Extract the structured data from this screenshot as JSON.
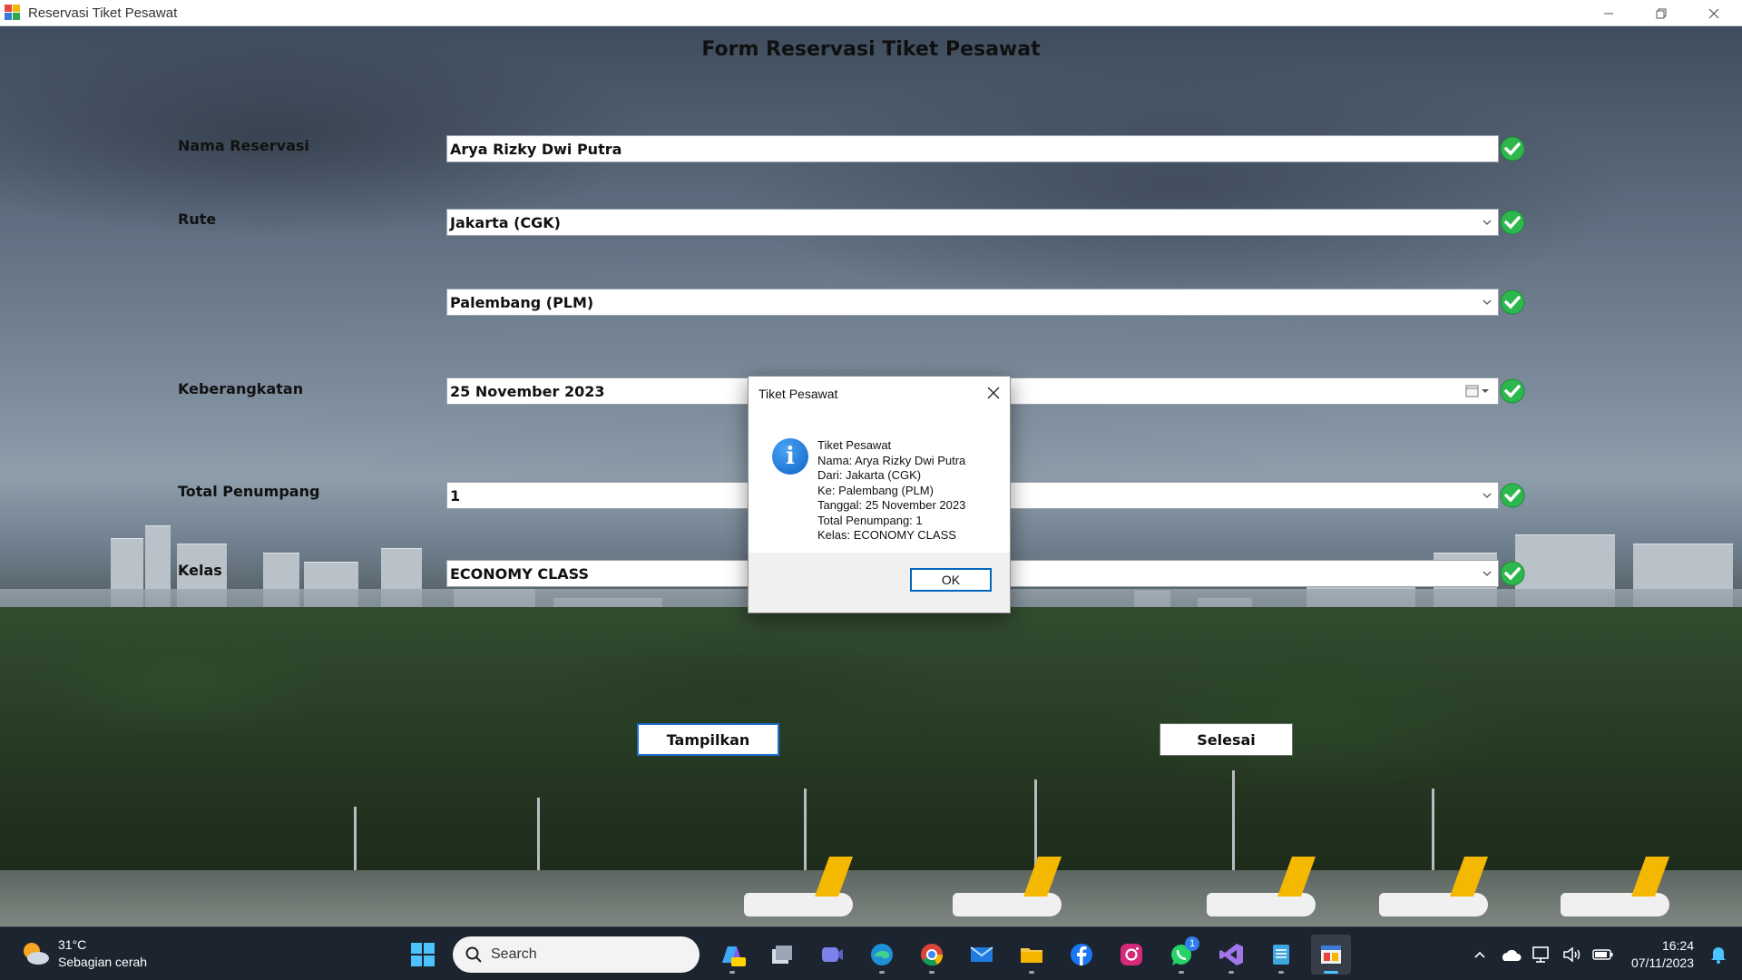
{
  "window": {
    "title": "Reservasi Tiket Pesawat",
    "minimize_icon": "minimize-icon",
    "maximize_icon": "restore-icon",
    "close_icon": "close-icon"
  },
  "form": {
    "title": "Form Reservasi Tiket Pesawat",
    "fields": {
      "nama": {
        "label": "Nama Reservasi",
        "value": "Arya Rizky Dwi Putra"
      },
      "rute_dari": {
        "label": "Rute",
        "value": "Jakarta (CGK)"
      },
      "rute_ke": {
        "value": "Palembang (PLM)"
      },
      "keberangkatan": {
        "label": "Keberangkatan",
        "value": "25 November  2023"
      },
      "penumpang": {
        "label": "Total Penumpang",
        "value": "1"
      },
      "kelas": {
        "label": "Kelas",
        "value": "ECONOMY CLASS"
      }
    },
    "buttons": {
      "tampilkan": "Tampilkan",
      "selesai": "Selesai"
    },
    "check_color": "#2db84d"
  },
  "dialog": {
    "title": "Tiket Pesawat",
    "icon": "info-icon",
    "lines": [
      "Tiket Pesawat",
      "Nama: Arya Rizky Dwi Putra",
      "Dari: Jakarta (CGK)",
      "Ke: Palembang (PLM)",
      "Tanggal: 25 November 2023",
      "Total Penumpang: 1",
      "Kelas: ECONOMY CLASS"
    ],
    "ok_label": "OK"
  },
  "taskbar": {
    "weather": {
      "temp": "31°C",
      "desc": "Sebagian cerah"
    },
    "search_placeholder": "Search",
    "apps": [
      "windows-start",
      "search",
      "copilot-pre",
      "task-view",
      "teams",
      "edge",
      "chrome",
      "mail",
      "file-explorer",
      "facebook",
      "instagram",
      "whatsapp",
      "visual-studio",
      "notepad",
      "winforms-app"
    ],
    "whatsapp_badge": "1",
    "clock": {
      "time": "16:24",
      "date": "07/11/2023"
    }
  }
}
